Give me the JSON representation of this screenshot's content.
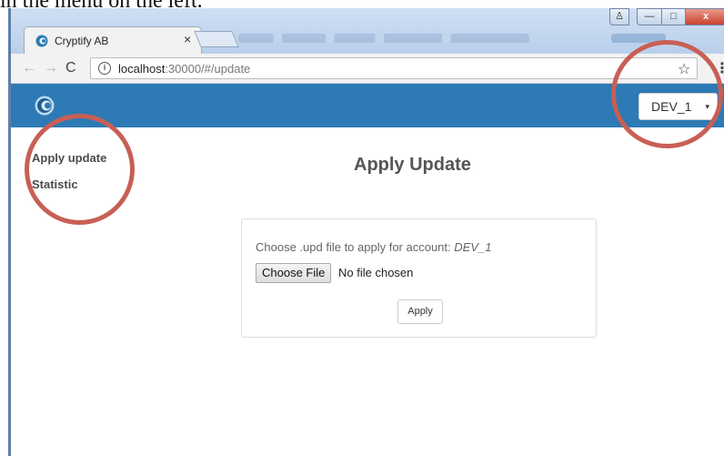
{
  "caption": "in the menu on the left.",
  "browser": {
    "tab_title": "Cryptify AB",
    "tab_close": "×",
    "url_host": "localhost",
    "url_path": ":30000/#/update",
    "info_glyph": "i",
    "star_glyph": "☆",
    "menu_glyph": "⋮",
    "back_glyph": "←",
    "forward_glyph": "→",
    "reload_glyph": "C",
    "window_user_glyph": "♙",
    "window_min_glyph": "—",
    "window_max_glyph": "□",
    "window_close_glyph": "x"
  },
  "header": {
    "account_selected": "DEV_1",
    "caret": "▾",
    "brand_color": "#2d7ab5"
  },
  "sidebar": {
    "items": [
      {
        "label": "Apply update"
      },
      {
        "label": "Statistic"
      }
    ]
  },
  "main": {
    "title": "Apply Update",
    "choose_prefix": "Choose .upd file to apply for account: ",
    "choose_account": "DEV_1",
    "file_button": "Choose File",
    "file_status": "No file chosen",
    "apply_button": "Apply"
  },
  "annotations": {
    "circle_color": "#c85f55"
  }
}
